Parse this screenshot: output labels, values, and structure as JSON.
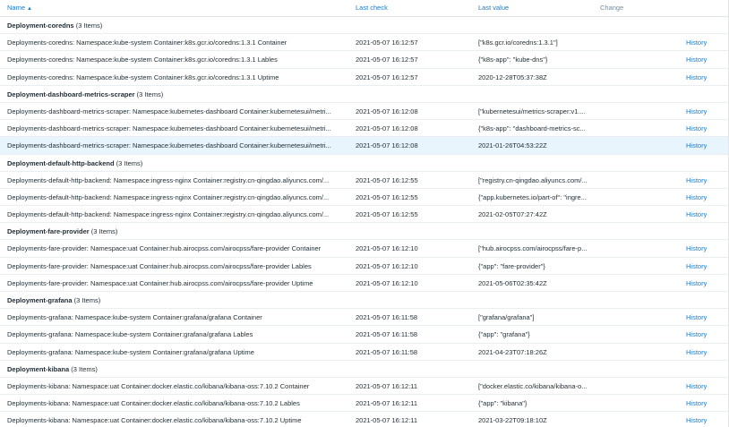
{
  "header": {
    "name_label": "Name",
    "sort_indicator": "▲",
    "last_check_label": "Last check",
    "last_value_label": "Last value",
    "change_label": "Change"
  },
  "history_label": "History",
  "groups": [
    {
      "title": "Deployment-coredns",
      "count": "(3 Items)",
      "items": [
        {
          "name": "Deployments-coredns: Namespace:kube-system Container:k8s.gcr.io/coredns:1.3.1 Container",
          "last_check": "2021-05-07 16:12:57",
          "last_value": "[\"k8s.gcr.io/coredns:1.3.1\"]"
        },
        {
          "name": "Deployments-coredns: Namespace:kube-system Container:k8s.gcr.io/coredns:1.3.1 Lables",
          "last_check": "2021-05-07 16:12:57",
          "last_value": "{\"k8s-app\": \"kube-dns\"}"
        },
        {
          "name": "Deployments-coredns: Namespace:kube-system Container:k8s.gcr.io/coredns:1.3.1 Uptime",
          "last_check": "2021-05-07 16:12:57",
          "last_value": "2020-12-28T05:37:38Z"
        }
      ]
    },
    {
      "title": "Deployment-dashboard-metrics-scraper",
      "count": "(3 Items)",
      "items": [
        {
          "name": "Deployments-dashboard-metrics-scraper: Namespace:kubernetes-dashboard Container:kubernetesui/metri...",
          "last_check": "2021-05-07 16:12:08",
          "last_value": "[\"kubernetesui/metrics-scraper:v1...."
        },
        {
          "name": "Deployments-dashboard-metrics-scraper: Namespace:kubernetes-dashboard Container:kubernetesui/metri...",
          "last_check": "2021-05-07 16:12:08",
          "last_value": "{\"k8s-app\": \"dashboard-metrics-sc..."
        },
        {
          "name": "Deployments-dashboard-metrics-scraper: Namespace:kubernetes-dashboard Container:kubernetesui/metri...",
          "last_check": "2021-05-07 16:12:08",
          "last_value": "2021-01-26T04:53:22Z",
          "selected": true
        }
      ]
    },
    {
      "title": "Deployment-default-http-backend",
      "count": "(3 Items)",
      "items": [
        {
          "name": "Deployments-default-http-backend: Namespace:ingress-nginx Container:registry.cn-qingdao.aliyuncs.com/...",
          "last_check": "2021-05-07 16:12:55",
          "last_value": "[\"registry.cn-qingdao.aliyuncs.com/..."
        },
        {
          "name": "Deployments-default-http-backend: Namespace:ingress-nginx Container:registry.cn-qingdao.aliyuncs.com/...",
          "last_check": "2021-05-07 16:12:55",
          "last_value": "{\"app.kubernetes.io/part-of\": \"ingre..."
        },
        {
          "name": "Deployments-default-http-backend: Namespace:ingress-nginx Container:registry.cn-qingdao.aliyuncs.com/...",
          "last_check": "2021-05-07 16:12:55",
          "last_value": "2021-02-05T07:27:42Z"
        }
      ]
    },
    {
      "title": "Deployment-fare-provider",
      "count": "(3 Items)",
      "items": [
        {
          "name": "Deployments-fare-provider: Namespace:uat Container:hub.airocpss.com/airocpss/fare-provider Container",
          "last_check": "2021-05-07 16:12:10",
          "last_value": "[\"hub.airocpss.com/airocpss/fare-p..."
        },
        {
          "name": "Deployments-fare-provider: Namespace:uat Container:hub.airocpss.com/airocpss/fare-provider Lables",
          "last_check": "2021-05-07 16:12:10",
          "last_value": "{\"app\": \"fare-provider\"}"
        },
        {
          "name": "Deployments-fare-provider: Namespace:uat Container:hub.airocpss.com/airocpss/fare-provider Uptime",
          "last_check": "2021-05-07 16:12:10",
          "last_value": "2021-05-06T02:35:42Z"
        }
      ]
    },
    {
      "title": "Deployment-grafana",
      "count": "(3 Items)",
      "items": [
        {
          "name": "Deployments-grafana: Namespace:kube-system Container:grafana/grafana Container",
          "last_check": "2021-05-07 16:11:58",
          "last_value": "[\"grafana/grafana\"]"
        },
        {
          "name": "Deployments-grafana: Namespace:kube-system Container:grafana/grafana Lables",
          "last_check": "2021-05-07 16:11:58",
          "last_value": "{\"app\": \"grafana\"}"
        },
        {
          "name": "Deployments-grafana: Namespace:kube-system Container:grafana/grafana Uptime",
          "last_check": "2021-05-07 16:11:58",
          "last_value": "2021-04-23T07:18:26Z"
        }
      ]
    },
    {
      "title": "Deployment-kibana",
      "count": "(3 Items)",
      "items": [
        {
          "name": "Deployments-kibana: Namespace:uat Container:docker.elastic.co/kibana/kibana-oss:7.10.2 Container",
          "last_check": "2021-05-07 16:12:11",
          "last_value": "[\"docker.elastic.co/kibana/kibana-o..."
        },
        {
          "name": "Deployments-kibana: Namespace:uat Container:docker.elastic.co/kibana/kibana-oss:7.10.2 Lables",
          "last_check": "2021-05-07 16:12:11",
          "last_value": "{\"app\": \"kibana\"}"
        },
        {
          "name": "Deployments-kibana: Namespace:uat Container:docker.elastic.co/kibana/kibana-oss:7.10.2 Uptime",
          "last_check": "2021-05-07 16:12:11",
          "last_value": "2021-03-22T09:18:10Z"
        }
      ]
    }
  ]
}
